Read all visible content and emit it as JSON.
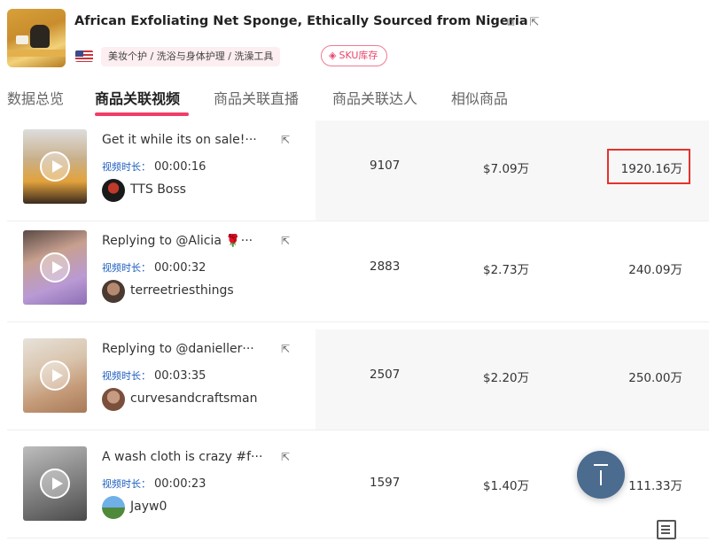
{
  "product": {
    "title": "African Exfoliating Net Sponge, Ethically Sourced from Nigeria",
    "category": "美妆个护 / 洗浴与身体护理 / 洗澡工具",
    "sku_tag": "SKU库存",
    "copy_icon": "copy-icon",
    "link_icon": "external-link-icon",
    "flag": "us-flag-icon"
  },
  "tabs": [
    {
      "label": "数据总览",
      "active": false
    },
    {
      "label": "商品关联视频",
      "active": true
    },
    {
      "label": "商品关联直播",
      "active": false
    },
    {
      "label": "商品关联达人",
      "active": false
    },
    {
      "label": "相似商品",
      "active": false
    }
  ],
  "duration_label": "视频时长：",
  "videos": [
    {
      "title": "Get it while its on sale!···",
      "duration": "00:00:16",
      "author": "TTS Boss",
      "views": "9107",
      "sales": "$7.09万",
      "gmv": "1920.16万",
      "highlighted": true
    },
    {
      "title": "Replying to @Alicia 🌹···",
      "duration": "00:00:32",
      "author": "terreetriesthings",
      "views": "2883",
      "sales": "$2.73万",
      "gmv": "240.09万",
      "highlighted": false
    },
    {
      "title": "Replying to @danieller···",
      "duration": "00:03:35",
      "author": "curvesandcraftsman",
      "views": "2507",
      "sales": "$2.20万",
      "gmv": "250.00万",
      "highlighted": false
    },
    {
      "title": "A wash cloth is crazy #f···",
      "duration": "00:00:23",
      "author": "Jayw0",
      "views": "1597",
      "sales": "$1.40万",
      "gmv": "111.33万",
      "highlighted": false
    }
  ],
  "colors": {
    "accent": "#ef3e69",
    "link_blue": "#1e5fbf",
    "highlight": "#e5322d",
    "fab": "#4b6b8f"
  }
}
